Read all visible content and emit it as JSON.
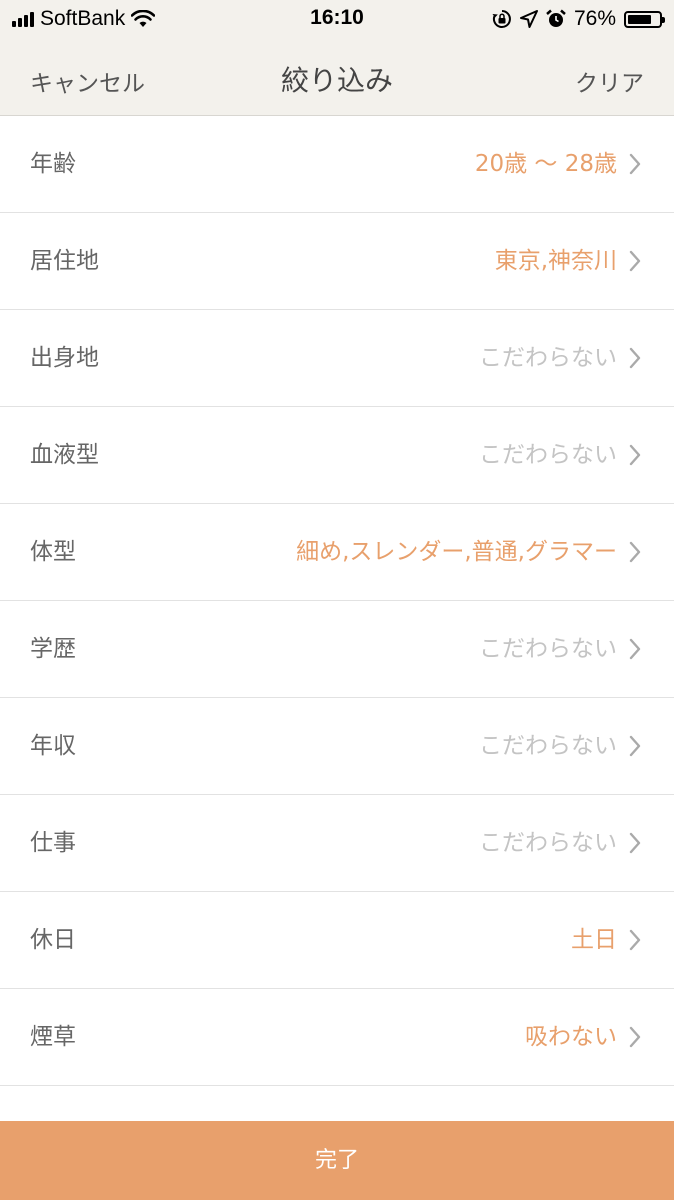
{
  "status_bar": {
    "carrier": "SoftBank",
    "time": "16:10",
    "battery_text": "76%",
    "battery_level": 0.76,
    "icons": [
      "signal-icon",
      "wifi-icon",
      "orientation-lock-icon",
      "location-icon",
      "alarm-icon",
      "battery-icon"
    ]
  },
  "nav": {
    "cancel_label": "キャンセル",
    "title": "絞り込み",
    "clear_label": "クリア"
  },
  "filters": [
    {
      "label": "年齢",
      "value": "20歳 〜 28歳",
      "state": "set"
    },
    {
      "label": "居住地",
      "value": "東京,神奈川",
      "state": "set"
    },
    {
      "label": "出身地",
      "value": "こだわらない",
      "state": "unset"
    },
    {
      "label": "血液型",
      "value": "こだわらない",
      "state": "unset"
    },
    {
      "label": "体型",
      "value": "細め,スレンダー,普通,グラマー",
      "state": "set"
    },
    {
      "label": "学歴",
      "value": "こだわらない",
      "state": "unset"
    },
    {
      "label": "年収",
      "value": "こだわらない",
      "state": "unset"
    },
    {
      "label": "仕事",
      "value": "こだわらない",
      "state": "unset"
    },
    {
      "label": "休日",
      "value": "土日",
      "state": "set"
    },
    {
      "label": "煙草",
      "value": "吸わない",
      "state": "set"
    }
  ],
  "footer": {
    "done_label": "完了"
  },
  "colors": {
    "accent": "#e8a06c",
    "placeholder": "#c4c4c4",
    "nav_background": "#f3f1ec",
    "label_text": "#666666"
  }
}
